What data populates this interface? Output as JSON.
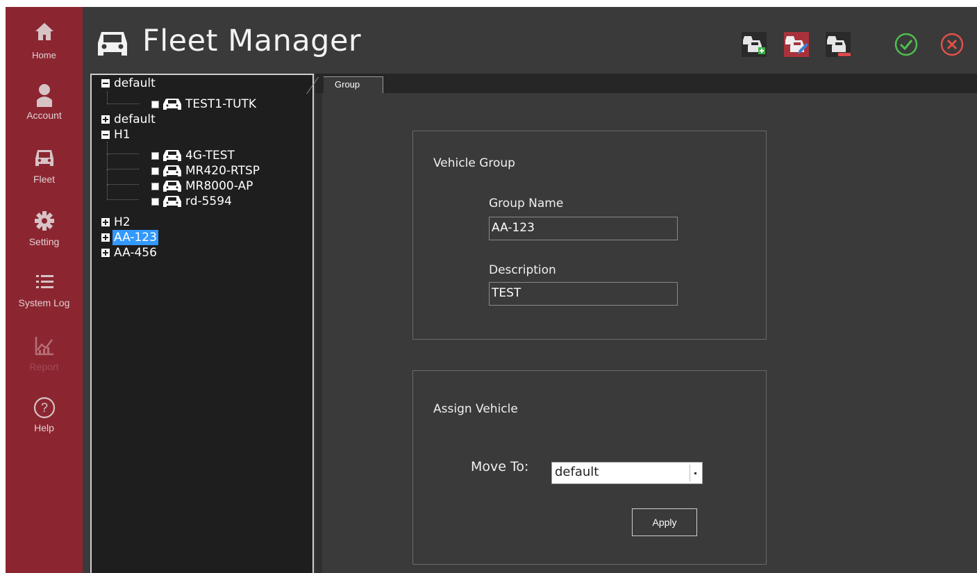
{
  "nav": {
    "items": [
      {
        "label": "Home",
        "icon": "home-icon"
      },
      {
        "label": "Account",
        "icon": "account-icon"
      },
      {
        "label": "Fleet",
        "icon": "car-icon"
      },
      {
        "label": "Setting",
        "icon": "gear-icon"
      },
      {
        "label": "System Log",
        "icon": "list-icon"
      },
      {
        "label": "Report",
        "icon": "chart-icon",
        "disabled": true
      },
      {
        "label": "Help",
        "icon": "help-icon"
      }
    ]
  },
  "header": {
    "title": "Fleet Manager",
    "toolbar": [
      {
        "icon": "add-vehicle-group-icon"
      },
      {
        "icon": "edit-vehicle-group-icon"
      },
      {
        "icon": "remove-vehicle-group-icon"
      },
      {
        "icon": "confirm-icon"
      },
      {
        "icon": "cancel-icon"
      }
    ]
  },
  "tree": {
    "groups": [
      {
        "label": "default",
        "expanded": true,
        "vehicles": [
          "TEST1-TUTK"
        ]
      },
      {
        "label": "default",
        "expanded": false,
        "vehicles": []
      },
      {
        "label": "H1",
        "expanded": true,
        "vehicles": [
          "4G-TEST",
          "MR420-RTSP",
          "MR8000-AP",
          "rd-5594"
        ]
      },
      {
        "label": "H2",
        "expanded": false,
        "vehicles": []
      },
      {
        "label": "AA-123",
        "expanded": false,
        "selected": true,
        "vehicles": []
      },
      {
        "label": "AA-456",
        "expanded": false,
        "vehicles": []
      }
    ]
  },
  "tabs": [
    {
      "label": "Group",
      "active": true
    }
  ],
  "vehicle_group": {
    "title": "Vehicle Group",
    "group_name_label": "Group Name",
    "group_name_value": "AA-123",
    "description_label": "Description",
    "description_value": "TEST"
  },
  "assign_vehicle": {
    "title": "Assign Vehicle",
    "move_to_label": "Move To:",
    "move_to_value": "default",
    "apply_label": "Apply"
  },
  "colors": {
    "nav_bg": "#8b2631",
    "app_bg": "#3a3a3a",
    "tree_bg": "#1e1e1e",
    "selection": "#3399ff",
    "confirm": "#4fbf4f",
    "cancel": "#e0504a"
  }
}
